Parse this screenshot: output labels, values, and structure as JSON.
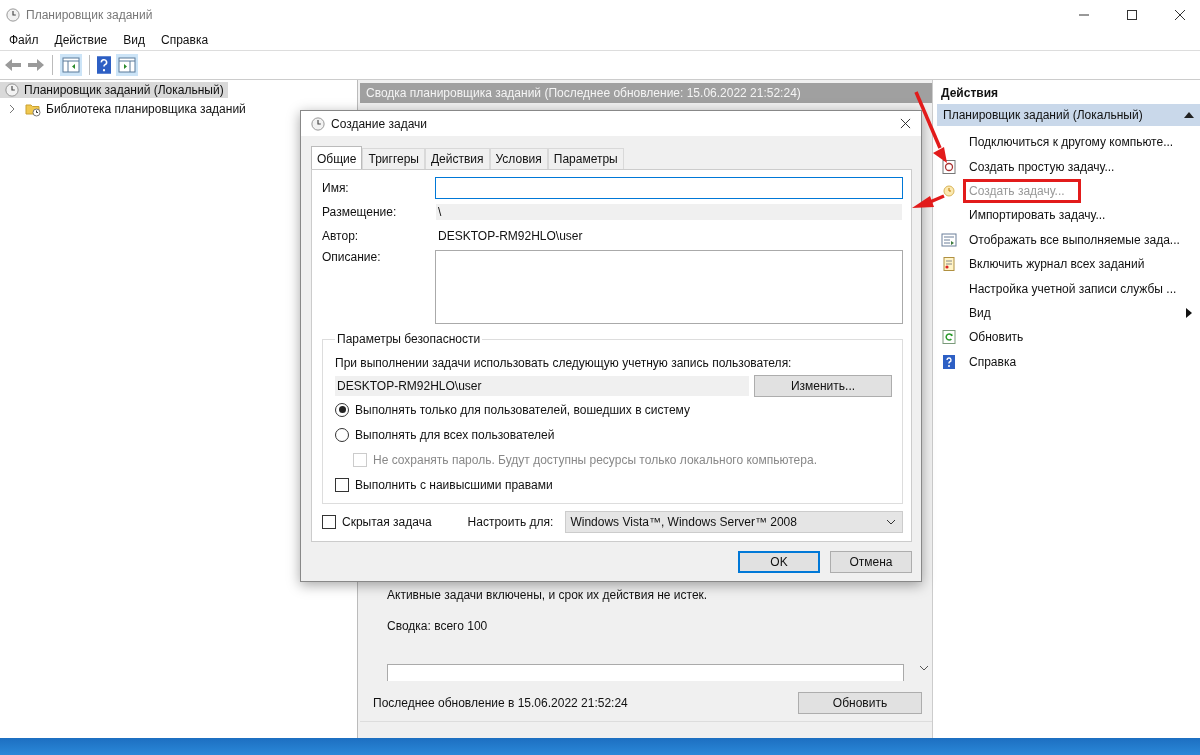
{
  "window": {
    "title": "Планировщик заданий"
  },
  "menu": [
    "Файл",
    "Действие",
    "Вид",
    "Справка"
  ],
  "tree": [
    {
      "label": "Планировщик заданий (Локальный)",
      "selected": true,
      "children": [
        {
          "label": "Библиотека планировщика заданий",
          "selected": false,
          "expanded": false
        }
      ]
    }
  ],
  "summary": {
    "header": "Сводка планировщика заданий (Последнее обновление: 15.06.2022 21:52:24)",
    "active_note": "Активные задачи включены, и срок их действия не истек.",
    "total": "Сводка: всего 100",
    "last_update": "Последнее обновление в 15.06.2022 21:52:24",
    "refresh_button": "Обновить"
  },
  "actions": {
    "header": "Действия",
    "group": "Планировщик заданий (Локальный)",
    "expanded": true,
    "items": [
      {
        "label": "Подключиться к другому компьюте...",
        "kind": "none",
        "disabled": false,
        "highlighted": false,
        "submenu": false
      },
      {
        "label": "Создать простую задачу...",
        "kind": "wizard",
        "disabled": false,
        "highlighted": false,
        "submenu": false
      },
      {
        "label": "Создать задачу...",
        "kind": "clock",
        "disabled": true,
        "highlighted": true,
        "submenu": false
      },
      {
        "label": "Импортировать задачу...",
        "kind": "none",
        "disabled": false,
        "highlighted": false,
        "submenu": false
      },
      {
        "label": "Отображать все выполняемые зада...",
        "kind": "list",
        "disabled": false,
        "highlighted": false,
        "submenu": false
      },
      {
        "label": "Включить журнал всех заданий",
        "kind": "log",
        "disabled": false,
        "highlighted": false,
        "submenu": false
      },
      {
        "label": "Настройка учетной записи службы ...",
        "kind": "none",
        "disabled": false,
        "highlighted": false,
        "submenu": false
      },
      {
        "label": "Вид",
        "kind": "none",
        "disabled": false,
        "highlighted": false,
        "submenu": true
      },
      {
        "label": "Обновить",
        "kind": "refresh",
        "disabled": false,
        "highlighted": false,
        "submenu": false
      },
      {
        "label": "Справка",
        "kind": "help",
        "disabled": false,
        "highlighted": false,
        "submenu": false
      }
    ]
  },
  "dialog": {
    "title": "Создание задачи",
    "tabs": [
      {
        "label": "Общие",
        "selected": true
      },
      {
        "label": "Триггеры",
        "selected": false
      },
      {
        "label": "Действия",
        "selected": false
      },
      {
        "label": "Условия",
        "selected": false
      },
      {
        "label": "Параметры",
        "selected": false
      }
    ],
    "name_label": "Имя:",
    "location_label": "Размещение:",
    "location_value": "\\",
    "author_label": "Автор:",
    "author_value": "DESKTOP-RM92HLO\\user",
    "description_label": "Описание:",
    "security": {
      "legend": "Параметры безопасности",
      "account_prompt": "При выполнении задачи использовать следующую учетную запись пользователя:",
      "account": "DESKTOP-RM92HLO\\user",
      "change_button": "Изменить...",
      "options": [
        {
          "kind": "radio",
          "label": "Выполнять только для пользователей, вошедших в систему",
          "selected": true,
          "disabled": false
        },
        {
          "kind": "radio",
          "label": "Выполнять для всех пользователей",
          "selected": false,
          "disabled": false,
          "children": [
            {
              "kind": "checkbox",
              "label": "Не сохранять пароль. Будут доступны ресурсы только локального компьютера.",
              "checked": false,
              "disabled": true
            }
          ]
        },
        {
          "kind": "checkbox",
          "label": "Выполнить с наивысшими правами",
          "checked": false,
          "disabled": false
        }
      ]
    },
    "hidden_label": "Скрытая задача",
    "hidden_checked": false,
    "configure_label": "Настроить для:",
    "configure_value": "Windows Vista™, Windows Server™ 2008",
    "ok": "OK",
    "cancel": "Отмена"
  }
}
